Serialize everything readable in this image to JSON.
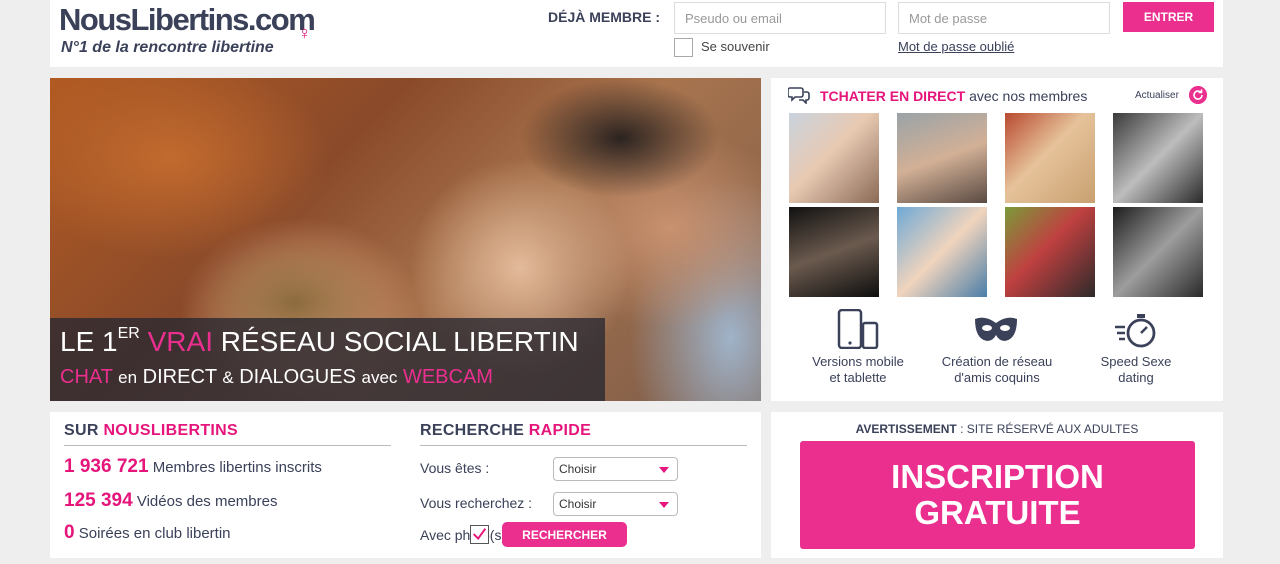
{
  "header": {
    "logo_part1": "Nous",
    "logo_part2": "Libertins",
    "logo_part3": ".com",
    "logo_glyph": "♀",
    "tagline": "N°1 de la rencontre libertine",
    "member_label": "DÉJÀ MEMBRE :",
    "pseudo_placeholder": "Pseudo ou email",
    "pseudo_value": "",
    "password_placeholder": "Mot de passe",
    "password_value": "",
    "enter_label": "ENTRER",
    "remember_label": "Se souvenir",
    "forgot_label": "Mot de passe oublié"
  },
  "hero": {
    "line1_a": "LE 1",
    "line1_sup": "ER",
    "line1_b": "VRAI",
    "line1_c": "RÉSEAU SOCIAL LIBERTIN",
    "line2_a": "CHAT",
    "line2_b": "en",
    "line2_c": "DIRECT",
    "line2_d": "&",
    "line2_e": "DIALOGUES",
    "line2_f": "avec",
    "line2_g": "WEBCAM"
  },
  "chat": {
    "title_highlight": "TCHATER EN DIRECT",
    "title_rest": "avec nos membres",
    "refresh_label": "Actualiser",
    "features": [
      {
        "icon": "mobile-tablet-icon",
        "line1": "Versions mobile",
        "line2": "et tablette"
      },
      {
        "icon": "mask-icon",
        "line1": "Création de réseau",
        "line2": "d'amis coquins"
      },
      {
        "icon": "stopwatch-icon",
        "line1": "Speed Sexe",
        "line2": "dating"
      }
    ]
  },
  "stats": {
    "title_a": "SUR",
    "title_b": "NOUSLIBERTINS",
    "items": [
      {
        "number": "1 936 721",
        "label": "Membres libertins inscrits"
      },
      {
        "number": "125 394",
        "label": "Vidéos des membres"
      },
      {
        "number": "0",
        "label": "Soirées en club libertin"
      }
    ]
  },
  "search": {
    "title_a": "RECHERCHE",
    "title_b": "RAPIDE",
    "you_are_label": "Vous êtes :",
    "you_are_value": "Choisir",
    "looking_label": "Vous recherchez :",
    "looking_value": "Choisir",
    "photo_label": "Avec photo(s)",
    "photo_checked": true,
    "button_label": "RECHERCHER"
  },
  "signup": {
    "warning_bold": "AVERTISSEMENT",
    "warning_rest": ": SITE RÉSERVÉ AUX ADULTES",
    "button_line1": "INSCRIPTION",
    "button_line2": "GRATUITE"
  },
  "colors": {
    "accent": "#ea2f8f",
    "brand_dark": "#3a4159",
    "background": "#eeeeee"
  }
}
